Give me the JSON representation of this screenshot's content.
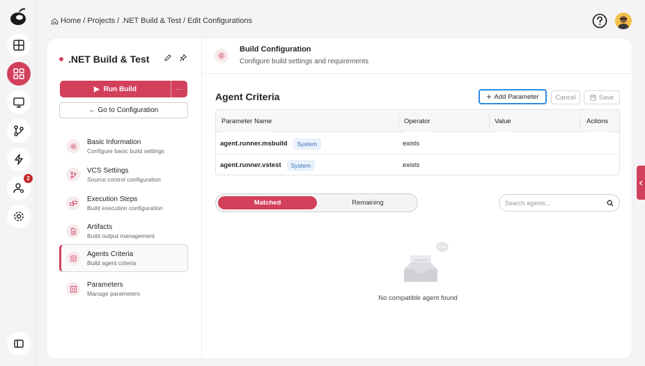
{
  "breadcrumb": {
    "home": "Home",
    "sep": "/",
    "projects": "Projects",
    "project": ".NET Build & Test",
    "current": "Edit Configurations"
  },
  "rail": {
    "notification_count": "2"
  },
  "sidebar": {
    "project_title": ".NET Build & Test",
    "run_label": "Run Build",
    "more_label": "···",
    "goto_label": "← Go to Configuration",
    "items": [
      {
        "title": "Basic Information",
        "subtitle": "Configure basic build settings"
      },
      {
        "title": "VCS Settings",
        "subtitle": "Source control configuration"
      },
      {
        "title": "Execution Steps",
        "subtitle": "Build execution configuration"
      },
      {
        "title": "Artifacts",
        "subtitle": "Build output management"
      },
      {
        "title": "Agents Criteria",
        "subtitle": "Build agent criteria"
      },
      {
        "title": "Parameters",
        "subtitle": "Manage parameters"
      }
    ]
  },
  "section": {
    "title": "Build Configuration",
    "subtitle": "Configure build settings and requirements"
  },
  "agent_criteria": {
    "title": "Agent Criteria",
    "add_label": "Add Parameter",
    "cancel_label": "Cancel",
    "save_label": "Save",
    "columns": [
      "Parameter Name",
      "Operator",
      "Value",
      "Actions"
    ],
    "rows": [
      {
        "name": "agent.runner.msbuild",
        "tag": "System",
        "operator": "exists",
        "value": ""
      },
      {
        "name": "agent.runner.vstest",
        "tag": "System",
        "operator": "exists",
        "value": ""
      }
    ]
  },
  "agents": {
    "tab_matched": "Matched",
    "tab_remaining": "Remaining",
    "search_placeholder": "Search agents...",
    "empty_text": "No compatible agent found"
  },
  "colors": {
    "accent": "#d3405c",
    "focus": "#2f8ae2",
    "tag_bg": "#e9f1fc",
    "tag_text": "#3a6fb8"
  }
}
